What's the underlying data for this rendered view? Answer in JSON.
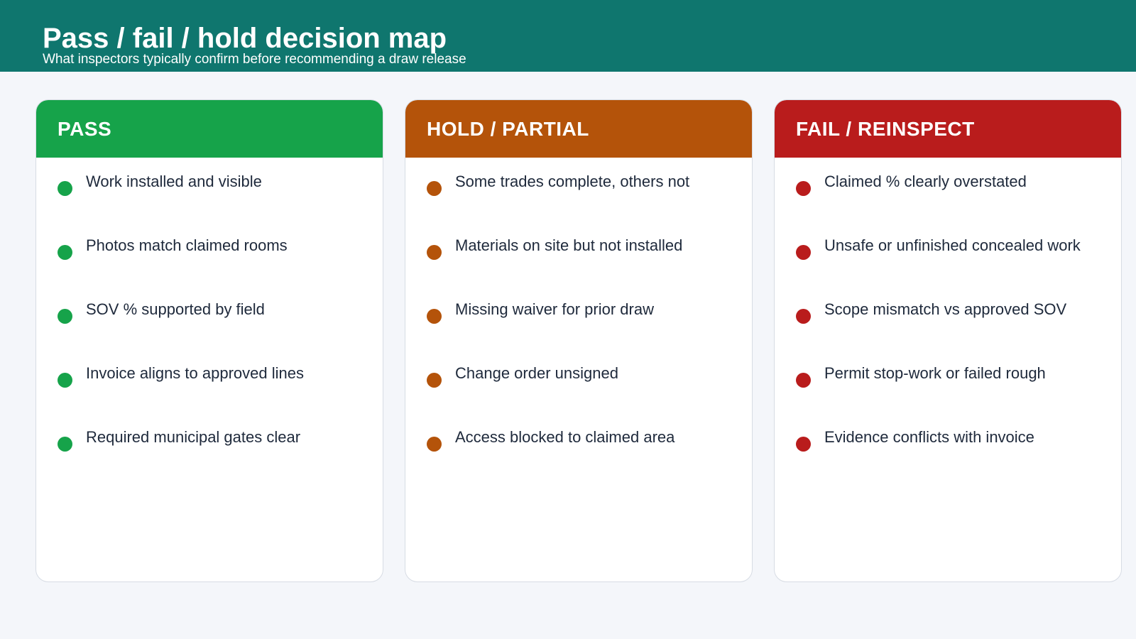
{
  "header": {
    "title": "Pass / fail / hold decision map",
    "subtitle": "What inspectors typically confirm before recommending a draw release"
  },
  "columns": [
    {
      "heading": "PASS",
      "color": "#16a34a",
      "items": [
        "Work installed and visible",
        "Photos match claimed rooms",
        "SOV % supported by field",
        "Invoice aligns to approved lines",
        "Required municipal gates clear"
      ]
    },
    {
      "heading": "HOLD / PARTIAL",
      "color": "#b4530a",
      "items": [
        "Some trades complete, others not",
        "Materials on site but not installed",
        "Missing waiver for prior draw",
        "Change order unsigned",
        "Access blocked to claimed area"
      ]
    },
    {
      "heading": "FAIL / REINSPECT",
      "color": "#b91c1c",
      "items": [
        "Claimed % clearly overstated",
        "Unsafe or unfinished concealed work",
        "Scope mismatch vs approved SOV",
        "Permit stop-work or failed rough",
        "Evidence conflicts with invoice"
      ]
    }
  ]
}
